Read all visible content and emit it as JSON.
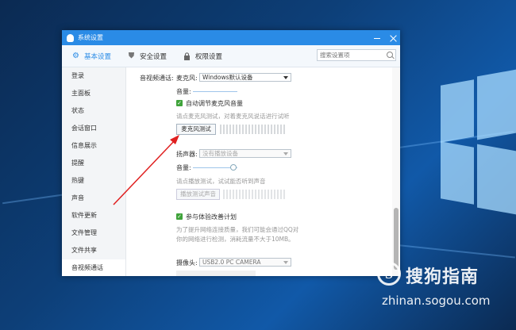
{
  "window": {
    "title": "系统设置",
    "tabs": [
      {
        "label": "基本设置",
        "icon": "gear-icon"
      },
      {
        "label": "安全设置",
        "icon": "shield-icon"
      },
      {
        "label": "权限设置",
        "icon": "lock-icon"
      }
    ],
    "search_placeholder": "搜索设置项"
  },
  "sidebar": {
    "items": [
      "登录",
      "主面板",
      "状态",
      "会话窗口",
      "信息展示",
      "提醒",
      "热键",
      "声音",
      "软件更新",
      "文件管理",
      "文件共享",
      "音视频通话"
    ],
    "active": "音视频通话"
  },
  "av_settings": {
    "section_label": "音视频通话:",
    "mic_label": "麦克风:",
    "mic_value": "Windows默认设备",
    "volume_label": "音量:",
    "auto_adjust_label": "自动调节麦克风音量",
    "auto_adjust_checked": true,
    "mic_hint": "请点麦克风测试，对着麦克风说话进行试听",
    "mic_test_button": "麦克风测试",
    "speaker_label": "扬声器:",
    "speaker_value": "没有播放设备",
    "speaker_volume_label": "音量:",
    "speaker_hint": "请点播放测试，试试能否听到声音",
    "play_test_button": "播放测试声音",
    "experience_label": "参与体验改善计划",
    "experience_checked": true,
    "experience_desc_1": "为了提升网络连接质量，我们可能会通过QQ对",
    "experience_desc_2": "你的网络进行检测，消耗流量不大于10MB。",
    "camera_label": "摄像头:",
    "camera_value": "USB2.0 PC CAMERA"
  },
  "watermark": {
    "logo_letter": "S",
    "title": "搜狗指南",
    "url": "zhinan.sogou.com"
  },
  "colors": {
    "titlebar": "#2a8be6",
    "arrow": "#e02020",
    "checkbox": "#3fa33a"
  }
}
